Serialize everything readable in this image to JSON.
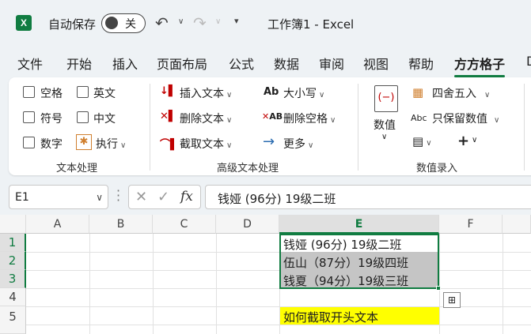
{
  "title_bar": {
    "autosave_label": "自动保存",
    "autosave_state": "关",
    "document_title": "工作簿1  -  Excel"
  },
  "tabs": [
    "文件",
    "开始",
    "插入",
    "页面布局",
    "公式",
    "数据",
    "审阅",
    "视图",
    "帮助",
    "方方格子",
    "D"
  ],
  "active_tab": "方方格子",
  "ribbon": {
    "text_group": {
      "items": [
        "空格",
        "英文",
        "符号",
        "中文",
        "数字",
        "执行"
      ],
      "label": "文本处理"
    },
    "advanced_group": {
      "insert": "插入文本",
      "delete": "删除文本",
      "extract": "截取文本",
      "case": "大小写",
      "delete_space": "删除空格",
      "more": "更多",
      "case_icon": "Ab",
      "space_icon": "AB",
      "label": "高级文本处理"
    },
    "number_group": {
      "value": "数值",
      "round": "四舍五入",
      "keep_value": "只保留数值",
      "keep_icon": "Abc",
      "plus": "+",
      "label": "数值录入"
    }
  },
  "formula_bar": {
    "name_box": "E1",
    "fx": "fx",
    "content": "钱娅 (96分) 19级二班"
  },
  "grid": {
    "columns": [
      "A",
      "B",
      "C",
      "D",
      "E",
      "F"
    ],
    "rows": [
      "1",
      "2",
      "3",
      "4",
      "5"
    ],
    "cells": {
      "E1": "钱娅 (96分) 19级二班",
      "E2": "伍山（87分）19级四班",
      "E3": "钱夏（94分）19级三班",
      "E5": "如何截取开头文本"
    }
  },
  "colors": {
    "accent": "#107c41",
    "highlight_gray": "#c5c5c5",
    "highlight_yellow": "#ffff00"
  }
}
